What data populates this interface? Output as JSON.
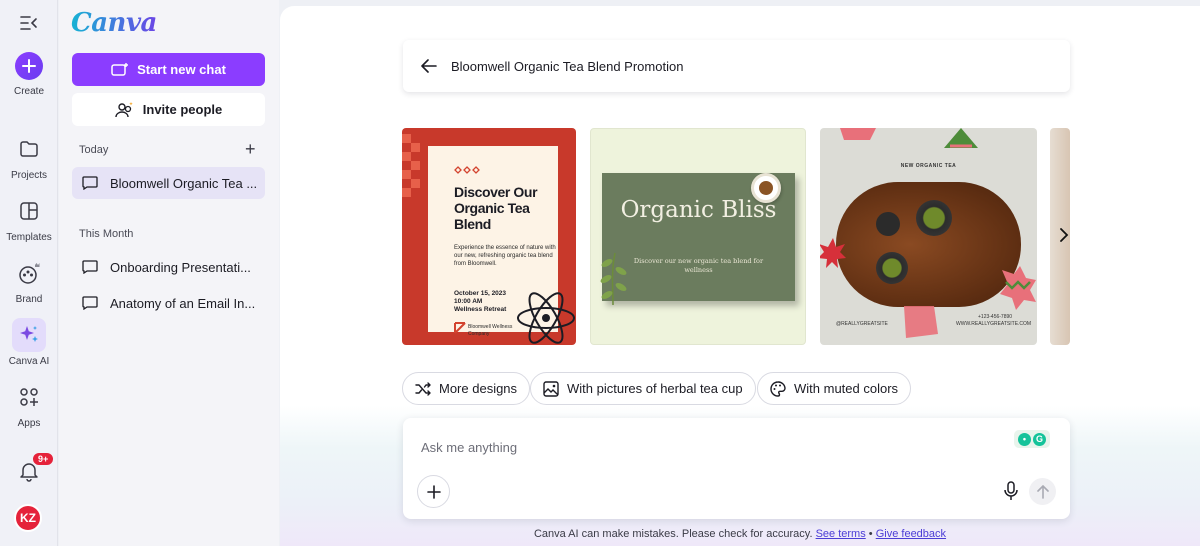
{
  "rail": {
    "items": [
      {
        "label": "Create"
      },
      {
        "label": "Projects"
      },
      {
        "label": "Templates"
      },
      {
        "label": "Brand"
      },
      {
        "label": "Canva AI"
      },
      {
        "label": "Apps"
      }
    ],
    "notification_badge": "9+",
    "avatar_initials": "KZ"
  },
  "sidebar": {
    "logo": "Canva",
    "new_chat": "Start new chat",
    "invite": "Invite people",
    "today_header": "Today",
    "today_items": [
      "Bloomwell Organic Tea ..."
    ],
    "month_header": "This Month",
    "month_items": [
      "Onboarding Presentati...",
      "Anatomy of an Email In..."
    ]
  },
  "main": {
    "title": "Bloomwell Organic Tea Blend Promotion",
    "cards": {
      "card1": {
        "heading": "Discover Our Organic Tea Blend",
        "body": "Experience the essence of nature with our new, refreshing organic tea blend from Bloomwell.",
        "date": "October 15, 2023",
        "time": "10:00 AM",
        "event": "Wellness Retreat",
        "company": "Bloomwell Wellness Company"
      },
      "card2": {
        "heading": "Organic Bliss",
        "body": "Discover our new organic tea blend for wellness"
      },
      "card3": {
        "label": "NEW ORGANIC TEA",
        "handle": "@REALLYGREATSITE",
        "phone": "+123-456-7890",
        "site": "WWW.REALLYGREATSITE.COM"
      }
    },
    "chips": [
      "More designs",
      "With pictures of herbal tea cup",
      "With muted colors"
    ],
    "input_placeholder": "Ask me anything",
    "disclaimer": "Canva AI can make mistakes. Please check for accuracy.",
    "see_terms": "See terms",
    "separator": "•",
    "give_feedback": "Give feedback"
  },
  "colors": {
    "brand_purple": "#8b3dff",
    "badge_red": "#e5223a",
    "card1_red": "#c8392b",
    "card2_green": "#6b7c5e"
  }
}
